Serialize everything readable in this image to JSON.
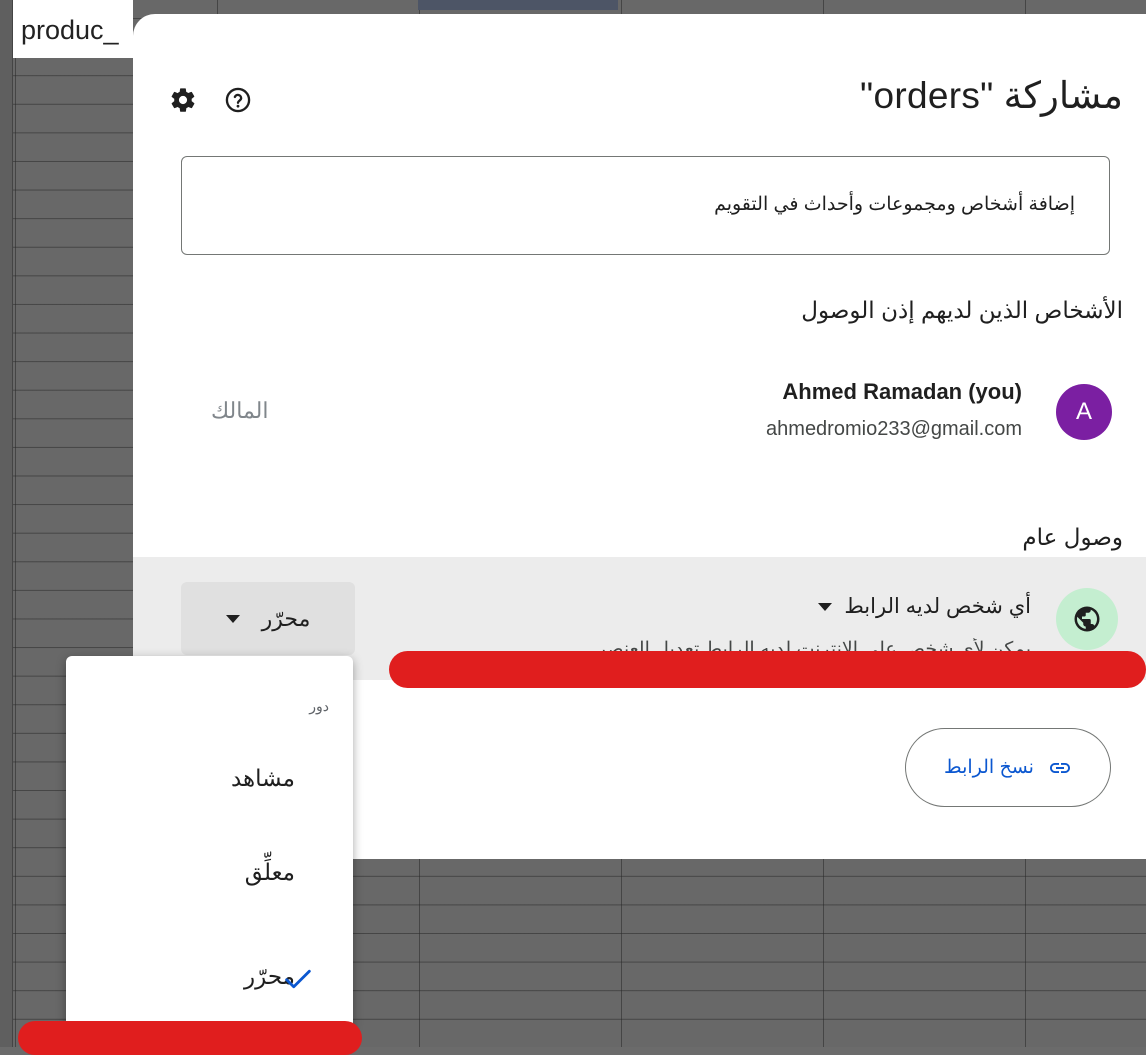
{
  "sheet": {
    "cell_text": "produc_"
  },
  "dialog": {
    "title": "مشاركة \"orders\"",
    "add_placeholder": "إضافة أشخاص ومجموعات وأحداث في التقويم",
    "people_label": "الأشخاص الذين لديهم إذن الوصول",
    "person": {
      "avatar_letter": "A",
      "name": "Ahmed Ramadan (you)",
      "email": "ahmedromio233@gmail.com",
      "role": "المالك"
    },
    "general_access_label": "وصول عام",
    "access_option": "أي شخص لديه الرابط",
    "access_description": "يمكن لأي شخص على الإنترنت لديه الرابط تعديل العنصر",
    "role_button": "محرّر",
    "copy_link": "نسخ الرابط",
    "avatar_color": "#7b1fa2"
  },
  "menu": {
    "header": "دور",
    "items": [
      "مشاهد",
      "معلِّق",
      "محرّر"
    ],
    "selected": "محرّر"
  }
}
